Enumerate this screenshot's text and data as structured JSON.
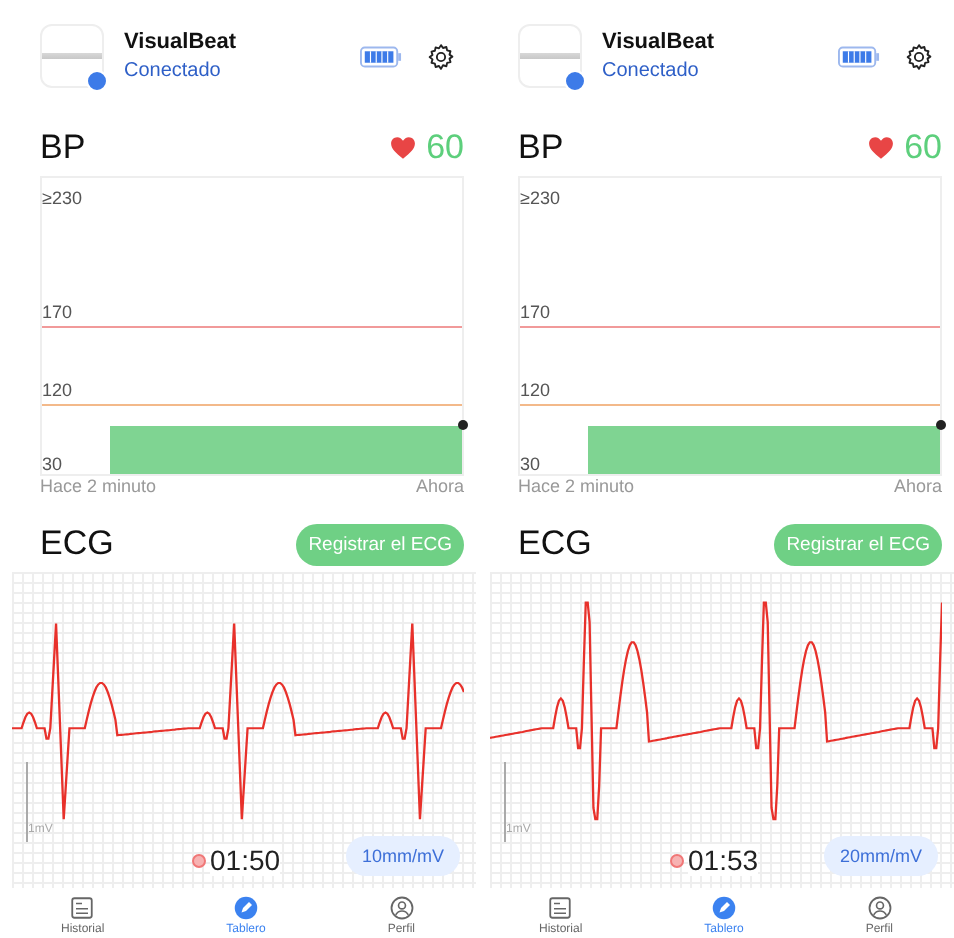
{
  "screens": [
    {
      "device": {
        "name": "VisualBeat",
        "status": "Conectado"
      },
      "bp": {
        "title": "BP",
        "heart_rate": "60",
        "y_labels": [
          "≥230",
          "170",
          "120",
          "30"
        ],
        "x_labels": [
          "Hace 2 minuto",
          "Ahora"
        ]
      },
      "ecg": {
        "title": "ECG",
        "record_button": "Registrar el ECG",
        "scale_label": "1mV",
        "timer": "01:50",
        "gain": "10mm/mV"
      },
      "nav": [
        {
          "kind": "history",
          "label": "Historial",
          "selected": false
        },
        {
          "kind": "dashboard",
          "label": "Tablero",
          "selected": true
        },
        {
          "kind": "profile",
          "label": "Perfil",
          "selected": false
        }
      ]
    },
    {
      "device": {
        "name": "VisualBeat",
        "status": "Conectado"
      },
      "bp": {
        "title": "BP",
        "heart_rate": "60",
        "y_labels": [
          "≥230",
          "170",
          "120",
          "30"
        ],
        "x_labels": [
          "Hace 2 minuto",
          "Ahora"
        ]
      },
      "ecg": {
        "title": "ECG",
        "record_button": "Registrar el ECG",
        "scale_label": "1mV",
        "timer": "01:53",
        "gain": "20mm/mV"
      },
      "nav": [
        {
          "kind": "history",
          "label": "Historial",
          "selected": false
        },
        {
          "kind": "dashboard",
          "label": "Tablero",
          "selected": true
        },
        {
          "kind": "profile",
          "label": "Perfil",
          "selected": false
        }
      ]
    }
  ]
}
